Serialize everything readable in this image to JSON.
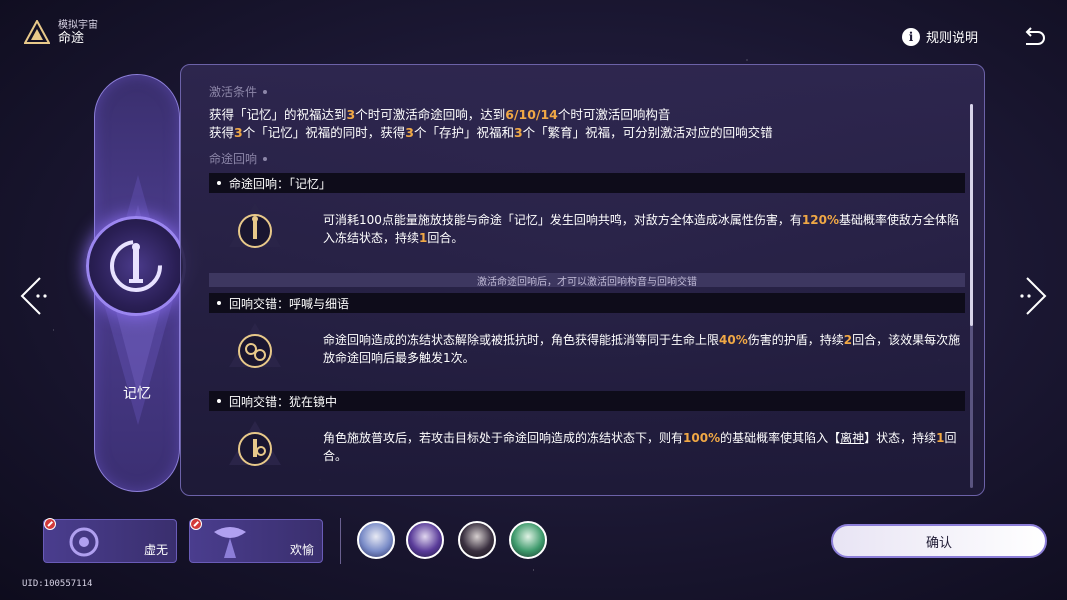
{
  "header": {
    "subtitle": "模拟宇宙",
    "title": "命途",
    "rules_label": "规则说明"
  },
  "path": {
    "name": "记忆"
  },
  "conditions": {
    "heading": "激活条件",
    "line1": {
      "a": "获得「记忆」的祝福达到",
      "n1": "3",
      "b": "个时可激活命途回响，达到",
      "n2": "6/10/14",
      "c": "个时可激活回响构音"
    },
    "line2": {
      "a": "获得",
      "n1": "3",
      "b": "个「记忆」祝福的同时，获得",
      "n2": "3",
      "c": "个「存护」祝福和",
      "n3": "3",
      "d": "个「繁育」祝福，可分别激活对应的回响交错"
    }
  },
  "echo": {
    "heading": "命途回响",
    "path_echo": {
      "title": "命途回响：「记忆」",
      "text_a": "可消耗100点能量施放技能与命途「记忆」发生回响共鸣，对敌方全体造成冰属性伤害，有",
      "hl1": "120%",
      "text_b": "基础概率使敌方全体陷入冻结状态，持续",
      "hl2": "1",
      "text_c": "回合。"
    },
    "notice": "激活命途回响后，才可以激活回响构音与回响交错",
    "interplay1": {
      "title": "回响交错：呼喊与细语",
      "text_a": "命途回响造成的冻结状态解除或被抵抗时，角色获得能抵消等同于生命上限",
      "hl1": "40%",
      "text_b": "伤害的护盾，持续",
      "hl2": "2",
      "text_c": "回合，该效果每次施放命途回响后最多触发1次。"
    },
    "interplay2": {
      "title": "回响交错：犹在镜中",
      "text_a": "角色施放普攻后，若攻击目标处于命途回响造成的冻结状态下，则有",
      "hl1": "100%",
      "text_b": "的基础概率使其陷入【",
      "keyword": "离神",
      "text_c": "】状态，持续",
      "hl2": "1",
      "text_d": "回合。"
    }
  },
  "bottom": {
    "card1": "虚无",
    "card2": "欢愉",
    "confirm": "确认",
    "uid": "UID:100557114"
  },
  "colors": {
    "highlight": "#f0a845",
    "accent": "#8c7ed8"
  }
}
